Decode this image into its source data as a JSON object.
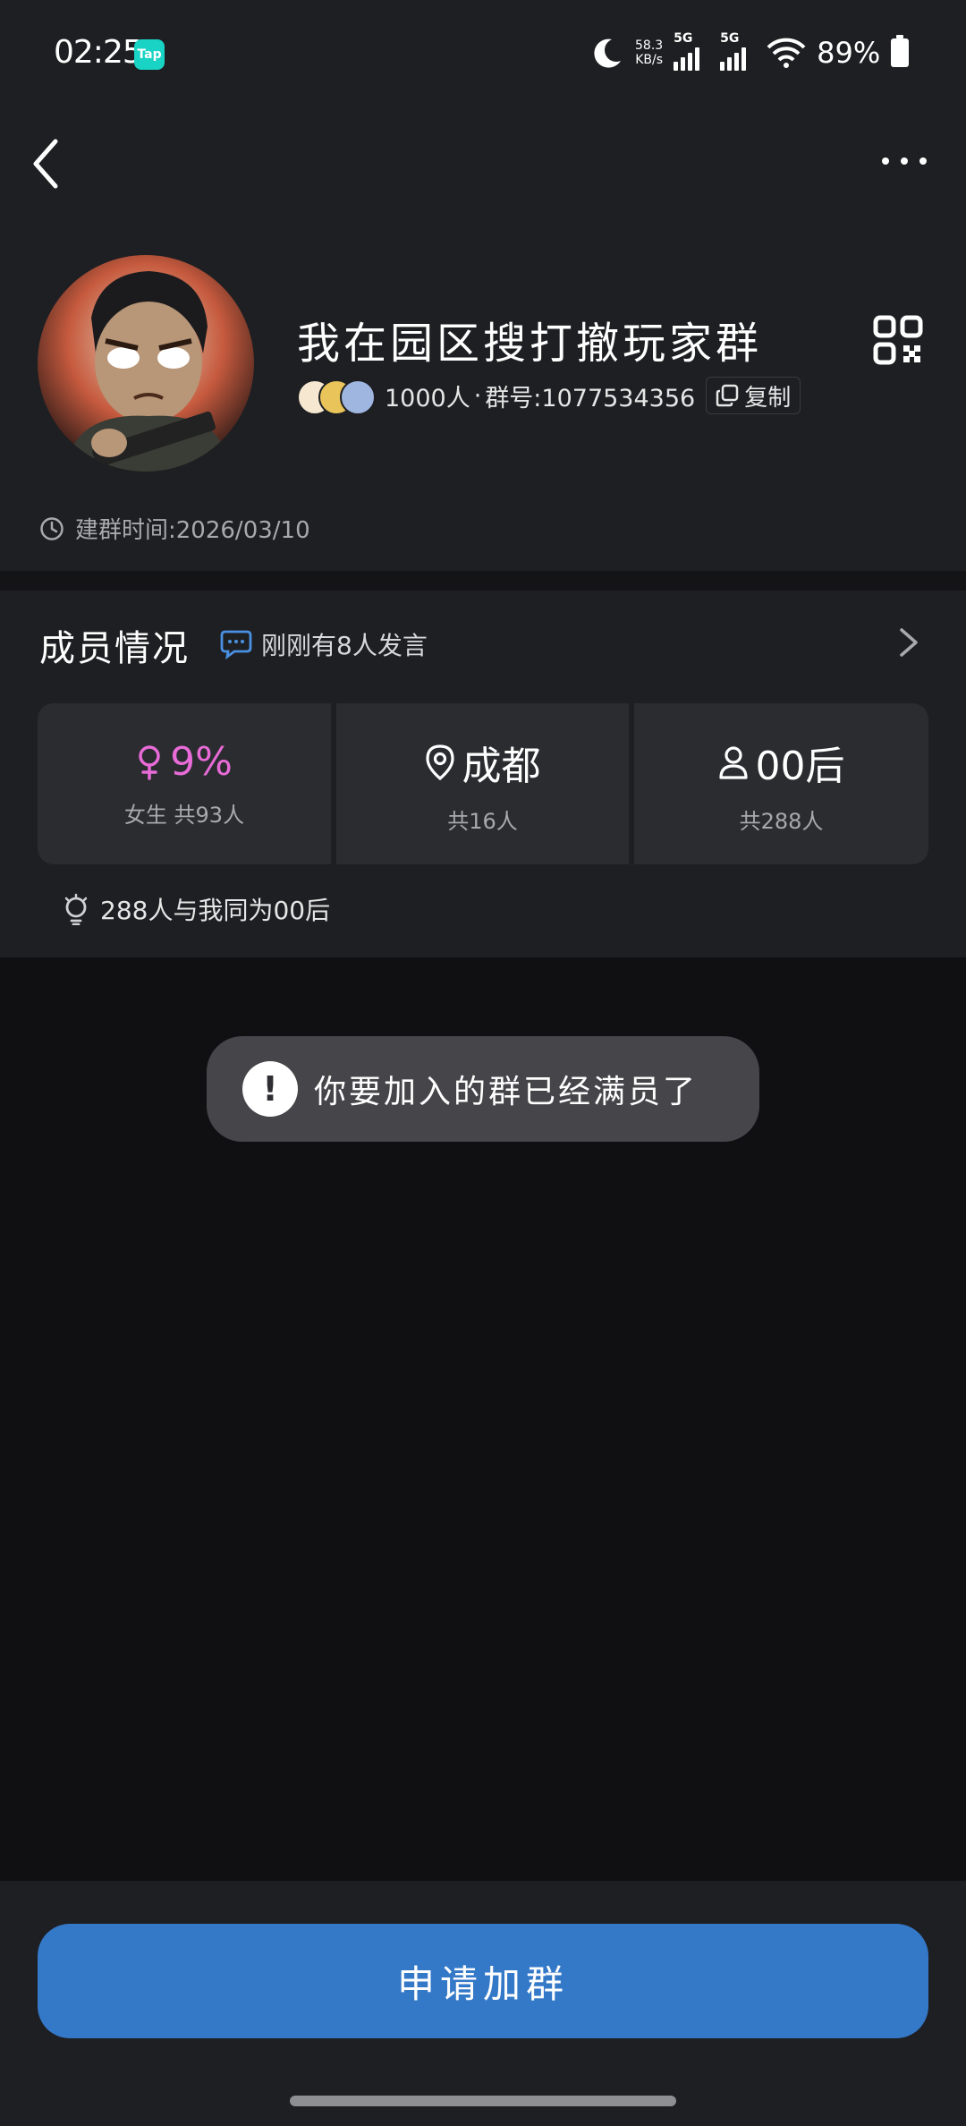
{
  "status_bar": {
    "time": "02:25",
    "app_badge": "Tap",
    "net_speed_value": "58.3",
    "net_speed_unit": "KB/s",
    "sim1_label": "5G",
    "sim2_label": "5G",
    "battery": "89%"
  },
  "group": {
    "name": "我在园区搜打撤玩家群",
    "member_count": "1000人",
    "group_id_text": "群号:1077534356",
    "copy_label": "复制",
    "created_label": "建群时间:",
    "created_date": "2026/03/10"
  },
  "members": {
    "title": "成员情况",
    "activity": "刚刚有8人发言",
    "stats": [
      {
        "main": "9%",
        "sub": "女生 共93人"
      },
      {
        "main": "成都",
        "sub": "共16人"
      },
      {
        "main": "00后",
        "sub": "共288人"
      }
    ],
    "same_age": "288人与我同为00后"
  },
  "toast": {
    "icon": "!",
    "text": "你要加入的群已经满员了"
  },
  "bottom": {
    "join_button": "申请加群"
  },
  "colors": {
    "accent_blue": "#3478C8",
    "female_pink": "#E86BD8",
    "chat_icon_blue": "#4A90E2",
    "tap_badge": "#19D3C5"
  }
}
